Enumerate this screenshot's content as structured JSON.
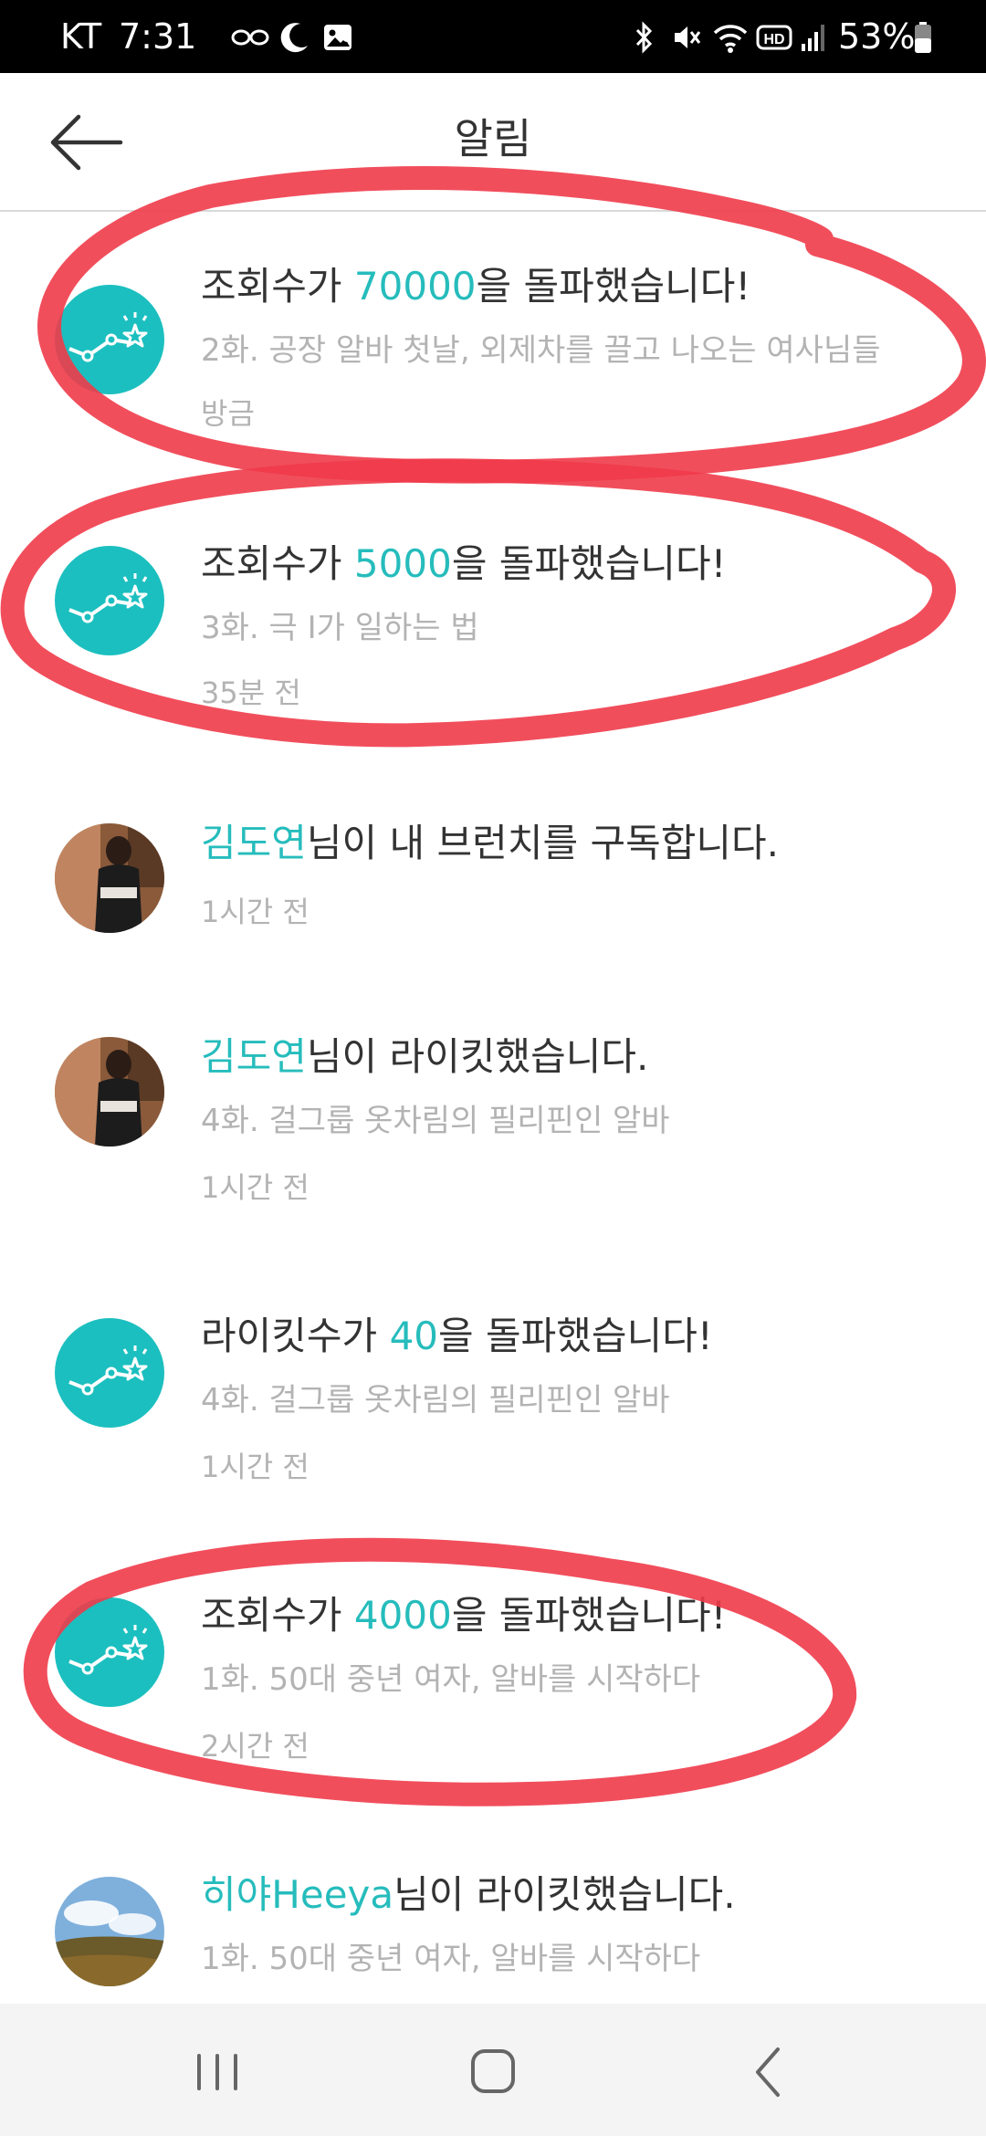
{
  "status_bar": {
    "carrier": "KT",
    "time": "7:31",
    "battery": "53%",
    "icons": [
      "link-icon",
      "moon-icon",
      "gallery-icon",
      "dot-icon",
      "bluetooth-icon",
      "mute-icon",
      "wifi-icon",
      "hd-icon",
      "signal-icon",
      "battery-icon"
    ]
  },
  "header": {
    "title": "알림",
    "back_icon": "arrow-left-icon"
  },
  "notifications": [
    {
      "avatar": "stats-star-icon",
      "title_pre": "조회수가 ",
      "title_hl": "70000",
      "title_post": "을 돌파했습니다!",
      "subtitle": "2화. 공장 알바 첫날, 외제차를 끌고 나오는 여사님들",
      "time": "방금"
    },
    {
      "avatar": "stats-star-icon",
      "title_pre": "조회수가 ",
      "title_hl": "5000",
      "title_post": "을 돌파했습니다!",
      "subtitle": "3화. 극 I가 일하는 법",
      "time": "35분 전"
    },
    {
      "avatar": "user-photo",
      "title_pre": "",
      "title_hl": "김도연",
      "title_post": "님이 내 브런치를 구독합니다.",
      "subtitle": "",
      "time": "1시간 전"
    },
    {
      "avatar": "user-photo",
      "title_pre": "",
      "title_hl": "김도연",
      "title_post": "님이 라이킷했습니다.",
      "subtitle": "4화. 걸그룹 옷차림의 필리핀인 알바",
      "time": "1시간 전"
    },
    {
      "avatar": "stats-star-icon",
      "title_pre": "라이킷수가 ",
      "title_hl": "40",
      "title_post": "을 돌파했습니다!",
      "subtitle": "4화. 걸그룹 옷차림의 필리핀인 알바",
      "time": "1시간 전"
    },
    {
      "avatar": "stats-star-icon",
      "title_pre": "조회수가 ",
      "title_hl": "4000",
      "title_post": "을 돌파했습니다!",
      "subtitle": "1화. 50대 중년 여자, 알바를 시작하다",
      "time": "2시간 전"
    },
    {
      "avatar": "user-photo",
      "title_pre": "",
      "title_hl": "히야Heeya",
      "title_post": "님이 라이킷했습니다.",
      "subtitle": "1화. 50대 중년 여자, 알바를 시작하다",
      "time": ""
    }
  ],
  "nav_bar": {
    "recents_icon": "recents-icon",
    "home_icon": "home-icon",
    "back_icon": "back-chevron-icon"
  },
  "colors": {
    "accent": "#26bcbc",
    "avatar_teal": "#1cbfbf",
    "annotation_red": "#ef3b4a"
  }
}
